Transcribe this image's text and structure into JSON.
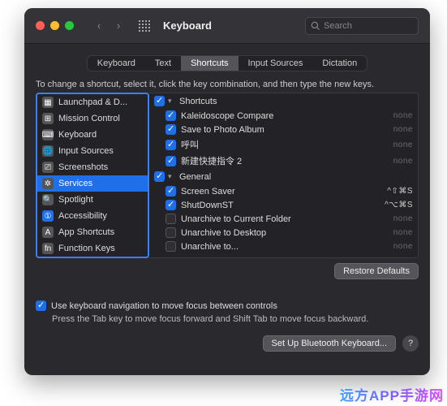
{
  "window": {
    "title": "Keyboard"
  },
  "search": {
    "placeholder": "Search"
  },
  "tabs": [
    "Keyboard",
    "Text",
    "Shortcuts",
    "Input Sources",
    "Dictation"
  ],
  "activeTab": 2,
  "instruction": "To change a shortcut, select it, click the key combination, and then type the new keys.",
  "categories": [
    {
      "label": "Launchpad & D..."
    },
    {
      "label": "Mission Control"
    },
    {
      "label": "Keyboard"
    },
    {
      "label": "Input Sources"
    },
    {
      "label": "Screenshots"
    },
    {
      "label": "Services"
    },
    {
      "label": "Spotlight"
    },
    {
      "label": "Accessibility"
    },
    {
      "label": "App Shortcuts"
    },
    {
      "label": "Function Keys"
    }
  ],
  "selectedCategory": 5,
  "groups": [
    {
      "name": "Shortcuts",
      "checked": true,
      "items": [
        {
          "checked": true,
          "label": "Kaleidoscope Compare",
          "shortcut": "none"
        },
        {
          "checked": true,
          "label": "Save to Photo Album",
          "shortcut": "none"
        },
        {
          "checked": true,
          "label": "呼叫",
          "shortcut": "none"
        },
        {
          "checked": true,
          "label": "新建快捷指令 2",
          "shortcut": "none"
        }
      ]
    },
    {
      "name": "General",
      "checked": true,
      "items": [
        {
          "checked": true,
          "label": "Screen Saver",
          "shortcut": "^⇧⌘S"
        },
        {
          "checked": true,
          "label": "ShutDownST",
          "shortcut": "^⌥⌘S"
        },
        {
          "checked": false,
          "label": "Unarchive to Current Folder",
          "shortcut": "none"
        },
        {
          "checked": false,
          "label": "Unarchive to Desktop",
          "shortcut": "none"
        },
        {
          "checked": false,
          "label": "Unarchive to...",
          "shortcut": "none"
        }
      ]
    }
  ],
  "buttons": {
    "restoreDefaults": "Restore Defaults",
    "setupBluetooth": "Set Up Bluetooth Keyboard..."
  },
  "navCheckbox": {
    "checked": true,
    "label": "Use keyboard navigation to move focus between controls"
  },
  "navHelp": "Press the Tab key to move focus forward and Shift Tab to move focus backward.",
  "watermark": "远方APP手游网"
}
